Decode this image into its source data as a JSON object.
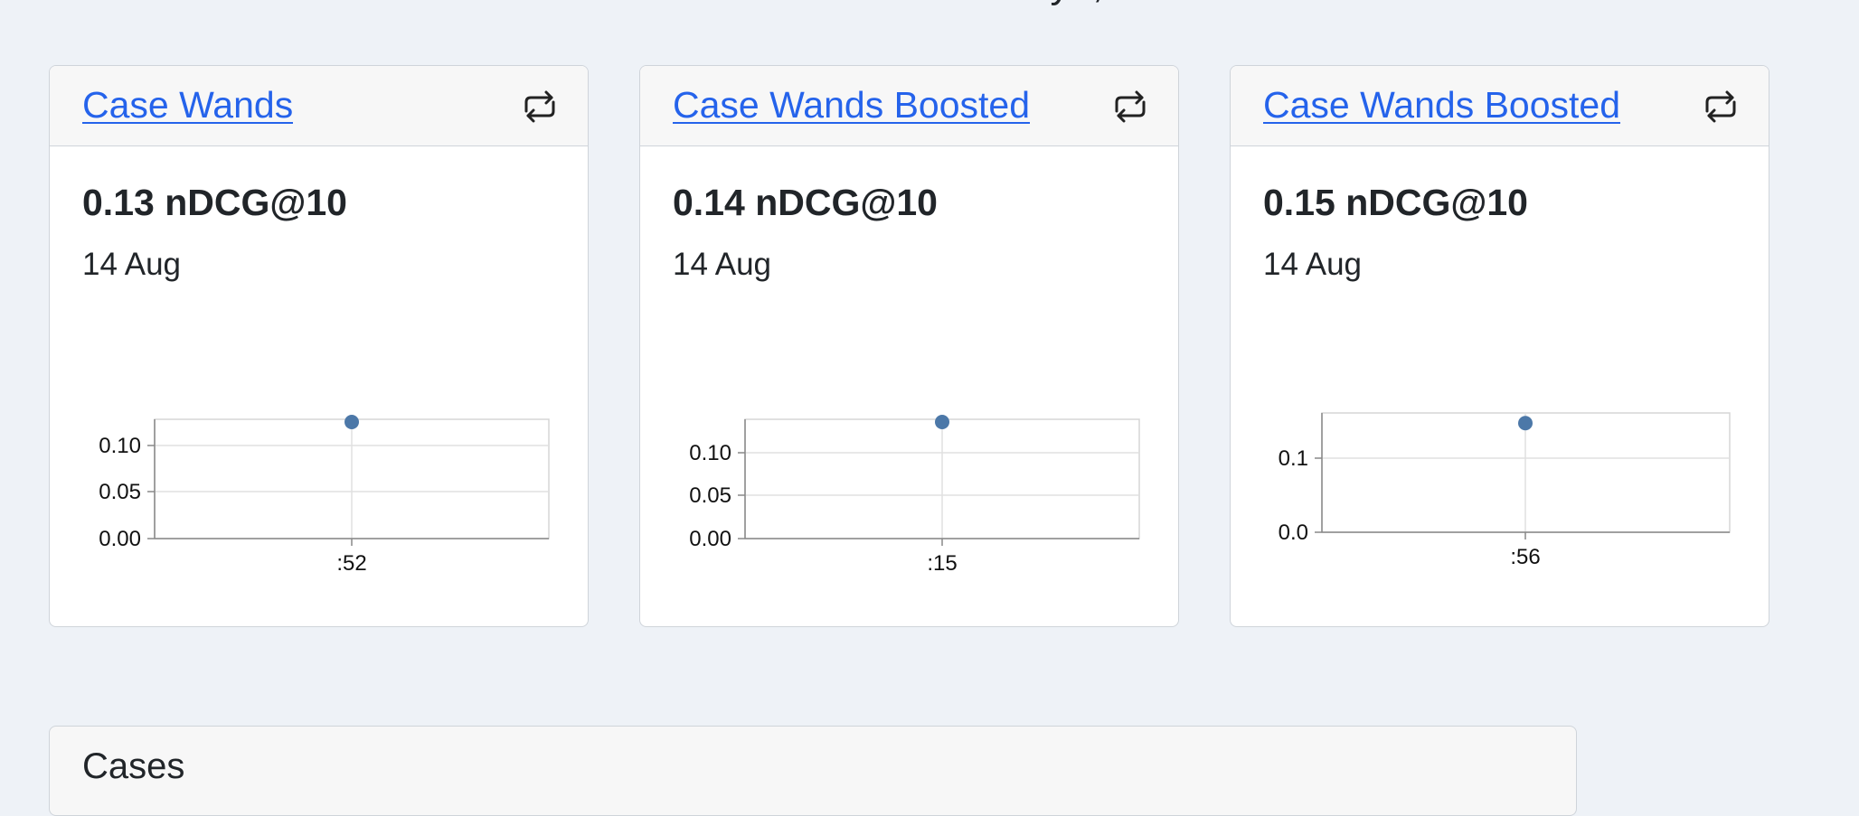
{
  "page": {
    "heading": "Hiya, Admin User"
  },
  "cards": [
    {
      "title": "Case Wands",
      "score": "0.13 nDCG@10",
      "date": "14 Aug",
      "refresh_icon": "refresh-icon"
    },
    {
      "title": "Case Wands Boosted",
      "score": "0.14 nDCG@10",
      "date": "14 Aug",
      "refresh_icon": "refresh-icon"
    },
    {
      "title": "Case Wands Boosted ",
      "score": "0.15 nDCG@10",
      "date": "14 Aug",
      "refresh_icon": "refresh-icon"
    }
  ],
  "cases_panel": {
    "title": "Cases"
  },
  "chart_data": [
    {
      "type": "scatter",
      "x": [
        ":52"
      ],
      "values": [
        0.13
      ],
      "yticks": [
        "0.00",
        "0.05",
        "0.10"
      ],
      "ylim": [
        0,
        0.13
      ],
      "point_color": "#4c78a8"
    },
    {
      "type": "scatter",
      "x": [
        ":15"
      ],
      "values": [
        0.14
      ],
      "yticks": [
        "0.00",
        "0.05",
        "0.10"
      ],
      "ylim": [
        0,
        0.14
      ],
      "point_color": "#4c78a8"
    },
    {
      "type": "scatter",
      "x": [
        ":56"
      ],
      "values": [
        0.15
      ],
      "yticks": [
        "0.0",
        "0.1"
      ],
      "ylim": [
        0,
        0.16
      ],
      "point_color": "#4c78a8"
    }
  ]
}
